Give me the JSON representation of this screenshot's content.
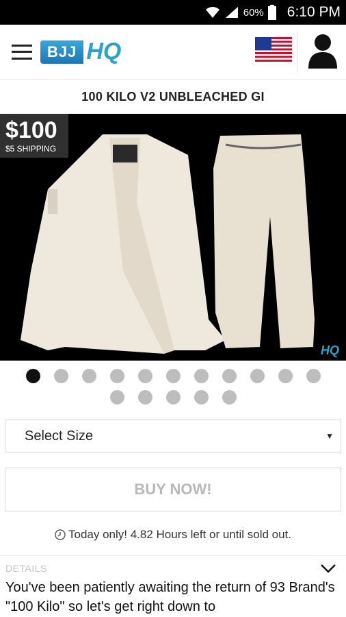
{
  "status_bar": {
    "battery": "60%",
    "time": "6:10 PM"
  },
  "app_bar": {
    "logo_bjj": "BJJ",
    "logo_hq": "HQ",
    "menu_icon": "hamburger-icon",
    "flag_icon": "us-flag-icon",
    "account_icon": "user-silhouette-icon"
  },
  "product": {
    "title": "100 KILO V2 UNBLEACHED GI",
    "price": "$100",
    "shipping": "$5 SHIPPING",
    "image_watermark": "HQ"
  },
  "carousel": {
    "total": 16,
    "active_index": 0
  },
  "size_select": {
    "selected": "Select Size",
    "caret": "▼"
  },
  "buy_button": {
    "label": "BUY NOW!"
  },
  "countdown": {
    "text": "Today only! 4.82 Hours left or until sold out."
  },
  "details": {
    "label": "DETAILS",
    "text": "You've been patiently awaiting the return of 93 Brand's \"100 Kilo\" so let's get right down to"
  },
  "colors": {
    "accent": "#2aa1cf",
    "price_tag_bg": "#303030",
    "disabled_text": "#b8b8b8"
  }
}
